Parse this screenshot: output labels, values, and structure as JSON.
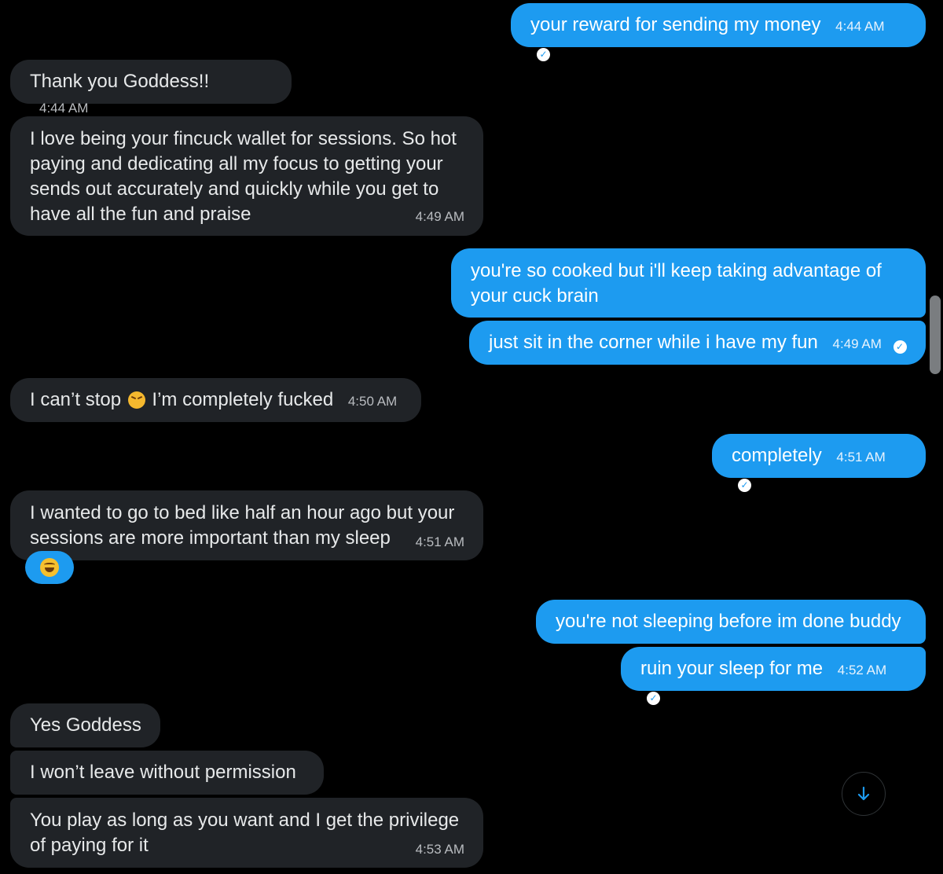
{
  "colors": {
    "background": "#000000",
    "incoming_bubble": "#202327",
    "outgoing_bubble": "#1d9bf0",
    "text": "#e7e9ea"
  },
  "messages": [
    {
      "direction": "outgoing",
      "text": "your reward for sending my money",
      "time": "4:44 AM",
      "seen": true
    },
    {
      "direction": "incoming",
      "text": "Thank you Goddess!!",
      "time": "4:44 AM"
    },
    {
      "direction": "incoming",
      "text": "I love being your fincuck wallet for sessions. So hot\npaying and dedicating all my focus to getting your\nsends out accurately and quickly while you get to\nhave all the fun and praise",
      "time": "4:49 AM"
    },
    {
      "direction": "outgoing",
      "text": "you're so cooked but i'll keep taking advantage of\nyour cuck brain"
    },
    {
      "direction": "outgoing",
      "text": "just sit in the corner while i have my fun",
      "time": "4:49 AM",
      "seen": true
    },
    {
      "direction": "incoming",
      "text_before_emoji": "I can’t stop",
      "emoji": "confounded-face-emoji",
      "text_after_emoji": "I’m completely fucked",
      "time": "4:50 AM"
    },
    {
      "direction": "outgoing",
      "text": "completely",
      "time": "4:51 AM",
      "seen": true
    },
    {
      "direction": "incoming",
      "text": "I wanted to go to bed like half an hour ago but your\nsessions are more important than my sleep",
      "time": "4:51 AM",
      "reaction": "face-with-tears-of-joy-emoji"
    },
    {
      "direction": "outgoing",
      "text": "you're not sleeping before im done buddy"
    },
    {
      "direction": "outgoing",
      "text": "ruin your sleep for me",
      "time": "4:52 AM",
      "seen": true
    },
    {
      "direction": "incoming",
      "text": "Yes Goddess"
    },
    {
      "direction": "incoming",
      "text": "I won’t leave without permission"
    },
    {
      "direction": "incoming",
      "text": "You play as long as you want and I get the privilege\nof paying for it",
      "time": "4:53 AM"
    }
  ],
  "controls": {
    "scroll_down_icon": "arrow-down-icon",
    "seen_icon": "check-circle-icon"
  }
}
